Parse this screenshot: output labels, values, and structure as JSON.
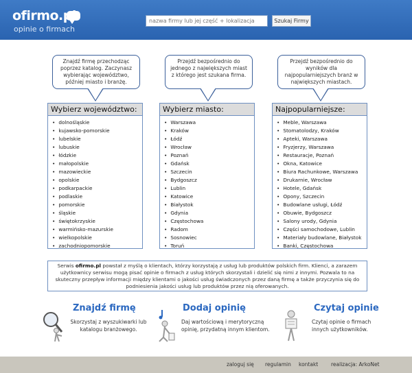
{
  "header": {
    "logo": "ofirmo.pl",
    "tagline": "opinie o firmach",
    "search_placeholder": "nazwa firmy lub jej część + lokalizacja",
    "search_button": "Szukaj Firmy"
  },
  "bubbles": [
    "Znajdź firmę przechodząc poprzez katalog. Zaczynasz wybierając województwo, później miasto i branżę.",
    "Przejdź bezpośrednio do jednego z największych miast z którego jest szukana firma.",
    "Przejdź bezpośrednio do wyników dla najpopularniejszych branż w największych miastach."
  ],
  "columns": {
    "voivodeships": {
      "title": "Wybierz województwo:",
      "items": [
        "dolnośląskie",
        "kujawsko-pomorskie",
        "lubelskie",
        "lubuskie",
        "łódzkie",
        "małopolskie",
        "mazowieckie",
        "opolskie",
        "podkarpackie",
        "podlaskie",
        "pomorskie",
        "śląskie",
        "świętokrzyskie",
        "warmińsko-mazurskie",
        "wielkopolskie",
        "zachodniopomorskie"
      ]
    },
    "cities": {
      "title": "Wybierz miasto:",
      "items": [
        "Warszawa",
        "Kraków",
        "Łódź",
        "Wrocław",
        "Poznań",
        "Gdańsk",
        "Szczecin",
        "Bydgoszcz",
        "Lublin",
        "Katowice",
        "Białystok",
        "Gdynia",
        "Częstochowa",
        "Radom",
        "Sosnowiec",
        "Toruń"
      ]
    },
    "popular": {
      "title": "Najpopularniejsze:",
      "items": [
        "Meble, Warszawa",
        "Stomatolodzy, Kraków",
        "Apteki, Warszawa",
        "Fryzjerzy, Warszawa",
        "Restauracje, Poznań",
        "Okna, Katowice",
        "Biura Rachunkowe, Warszawa",
        "Drukarnie, Wrocław",
        "Hotele, Gdańsk",
        "Opony, Szczecin",
        "Budowlane usługi, Łódź",
        "Obuwie, Bydgoszcz",
        "Salony urody, Gdynia",
        "Części samochodowe, Lublin",
        "Materiały budowlane, Białystok",
        "Banki, Częstochowa"
      ]
    }
  },
  "description": {
    "prefix": "Serwis ",
    "brand": "ofirmo.pl",
    "text": " powstał z myślą o klientach, którzy korzystają z usług lub produktów polskich firm. Klienci, a zarazem użytkownicy serwisu mogą pisać opinie o firmach z usług których skorzystali i dzielić się nimi z innymi. Pozwala to na skuteczny przepływ informacji między klientami o jakości usług świadczonych przez daną firmę a także przyczynia się do podniesienia jakości usług lub produktów przez nią oferowanych."
  },
  "features": [
    {
      "title": "Znajdź firmę",
      "text": "Skorzystaj z wyszukiwarki lub katalogu branżowego.",
      "icon": "magnifier-person-icon"
    },
    {
      "title": "Dodaj opinię",
      "text": "Daj wartościową i merytoryczną opinię, przydatną innym klientom.",
      "icon": "writing-person-icon"
    },
    {
      "title": "Czytaj opinie",
      "text": "Czytaj opinie o firmach innych użytkowników.",
      "icon": "reading-person-icon"
    }
  ],
  "footer": {
    "login": "zaloguj się",
    "rules": "regulamin",
    "contact": "kontakt",
    "credit": "realizacja: ArkoNet"
  }
}
